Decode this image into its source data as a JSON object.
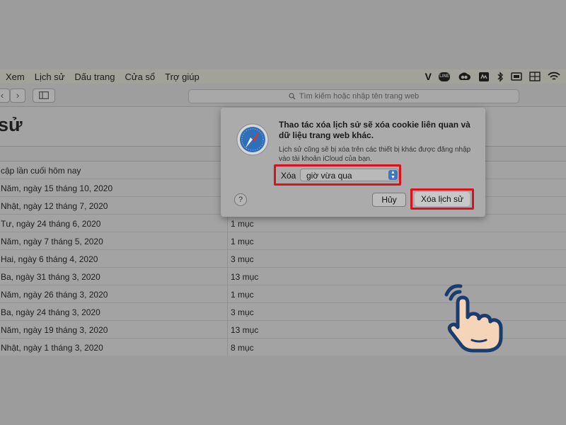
{
  "menu": [
    "Xem",
    "Lịch sử",
    "Dấu trang",
    "Cửa sổ",
    "Trợ giúp"
  ],
  "status_icons": [
    "vpn-v-icon",
    "line-icon",
    "creative-cloud-icon",
    "app-icon",
    "bluetooth-icon",
    "display-icon",
    "grid-icon",
    "wifi-icon"
  ],
  "status_v": "V",
  "status_line": "LINE",
  "toolbar": {
    "back": "‹",
    "forward": "›",
    "search_placeholder": "Tìm kiếm hoặc nhập tên trang web"
  },
  "page_title": "sử",
  "history_rows": [
    {
      "date": "cập lần cuối hôm nay",
      "count": ""
    },
    {
      "date": "Năm, ngày 15 tháng 10, 2020",
      "count": ""
    },
    {
      "date": "Nhật, ngày 12 tháng 7, 2020",
      "count": ""
    },
    {
      "date": "Tư, ngày 24 tháng 6, 2020",
      "count": "1 mục"
    },
    {
      "date": "Năm, ngày 7 tháng 5, 2020",
      "count": "1 mục"
    },
    {
      "date": "Hai, ngày 6 tháng 4, 2020",
      "count": "3 mục"
    },
    {
      "date": "Ba, ngày 31 tháng 3, 2020",
      "count": "13 mục"
    },
    {
      "date": "Năm, ngày 26 tháng 3, 2020",
      "count": "1 mục"
    },
    {
      "date": "Ba, ngày 24 tháng 3, 2020",
      "count": "3 mục"
    },
    {
      "date": "Năm, ngày 19 tháng 3, 2020",
      "count": "13 mục"
    },
    {
      "date": "Nhật, ngày 1 tháng 3, 2020",
      "count": "8 mục"
    },
    {
      "date": "",
      "count": ""
    }
  ],
  "dialog": {
    "title": "Thao tác xóa lịch sử sẽ xóa cookie liên quan và dữ liệu trang web khác.",
    "description": "Lịch sử cũng sẽ bị xóa trên các thiết bị khác được đăng nhập vào tài khoản iCloud của bạn.",
    "clear_label": "Xóa",
    "period_value": "giờ vừa qua",
    "help": "?",
    "cancel": "Hủy",
    "confirm": "Xóa lịch sử"
  },
  "colors": {
    "highlight": "#d9121c",
    "hand_outline": "#1b3d6e",
    "hand_fill": "#f6d4b8",
    "select_arrow": "#3a78c6"
  }
}
